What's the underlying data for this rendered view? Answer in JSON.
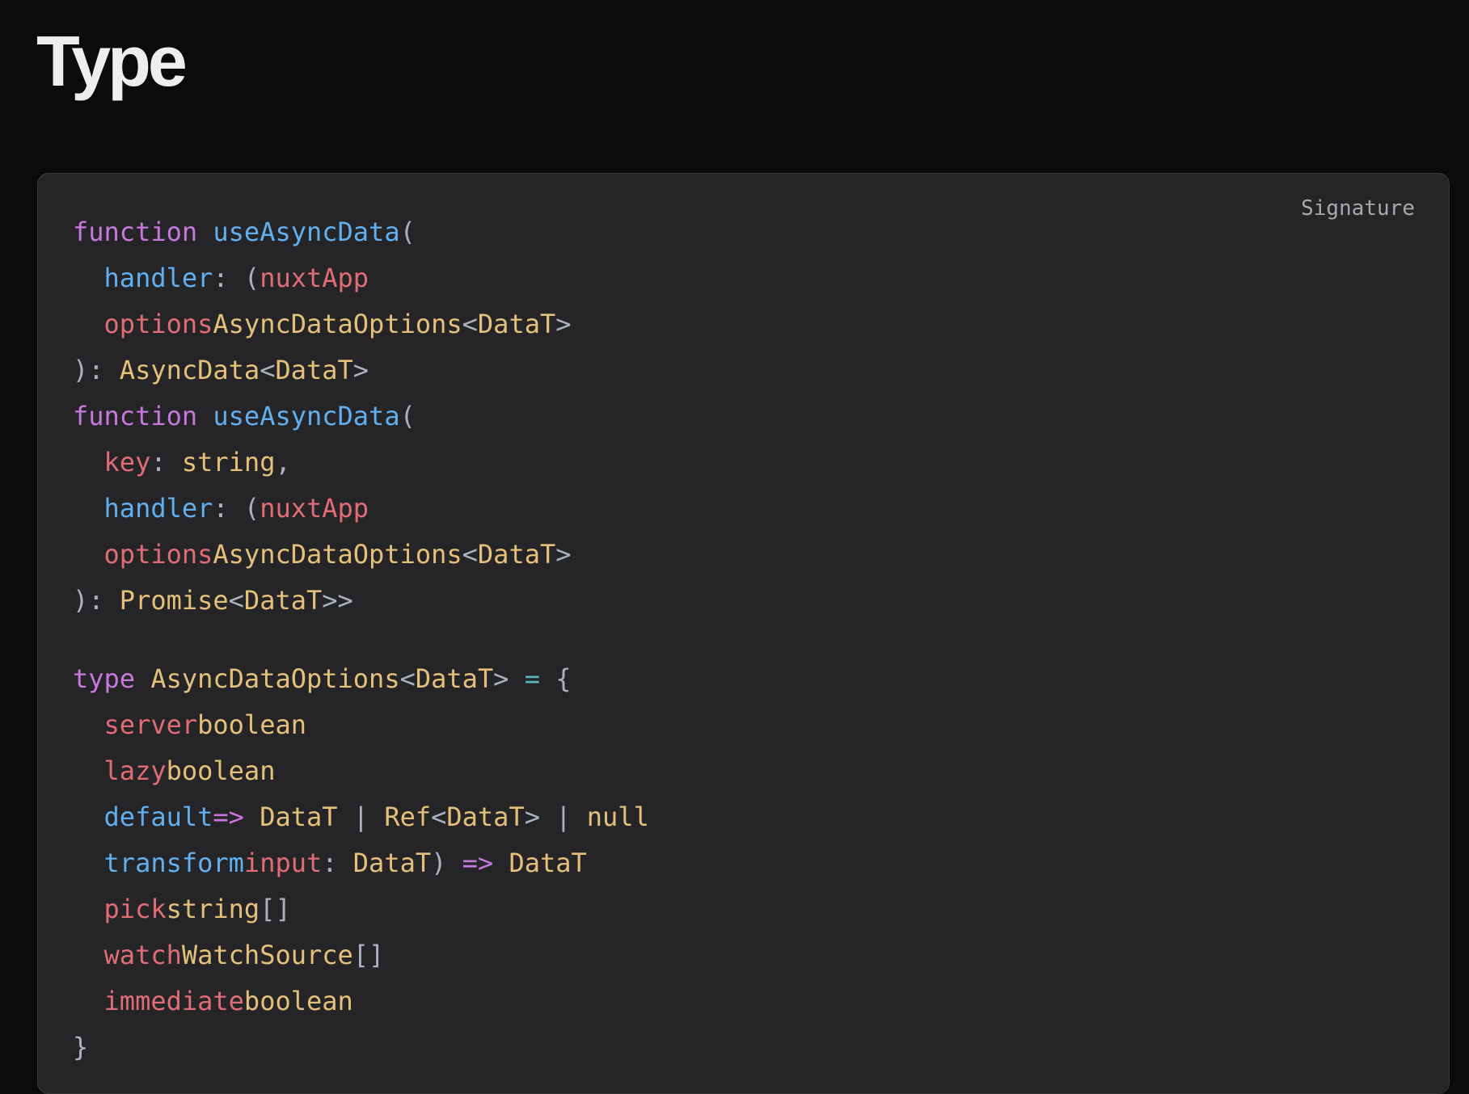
{
  "page": {
    "title": "Type"
  },
  "code_block": {
    "label": "Signature",
    "colors": {
      "keyword": "#c678dd",
      "function": "#61afef",
      "variable": "#e06c75",
      "type": "#e5c07b",
      "punctuation": "#abb2bf",
      "operator": "#56b6c2",
      "background": "#252527"
    },
    "lines": [
      [
        {
          "t": "function",
          "c": "kw"
        },
        {
          "t": " ",
          "c": "punc"
        },
        {
          "t": "useAsyncData",
          "c": "fn"
        },
        {
          "t": "(",
          "c": "punc"
        }
      ],
      [
        {
          "t": "  ",
          "c": "punc"
        },
        {
          "t": "handler",
          "c": "fn"
        },
        {
          "t": ": (",
          "c": "punc"
        },
        {
          "t": "nuxtApp",
          "c": "var"
        }
      ],
      [
        {
          "t": "  ",
          "c": "punc"
        },
        {
          "t": "options",
          "c": "var"
        },
        {
          "t": "AsyncDataOptions",
          "c": "type"
        },
        {
          "t": "<",
          "c": "punc"
        },
        {
          "t": "DataT",
          "c": "type"
        },
        {
          "t": ">",
          "c": "punc"
        }
      ],
      [
        {
          "t": "): ",
          "c": "punc"
        },
        {
          "t": "AsyncData",
          "c": "type"
        },
        {
          "t": "<",
          "c": "punc"
        },
        {
          "t": "DataT",
          "c": "type"
        },
        {
          "t": ">",
          "c": "punc"
        }
      ],
      [
        {
          "t": "function",
          "c": "kw"
        },
        {
          "t": " ",
          "c": "punc"
        },
        {
          "t": "useAsyncData",
          "c": "fn"
        },
        {
          "t": "(",
          "c": "punc"
        }
      ],
      [
        {
          "t": "  ",
          "c": "punc"
        },
        {
          "t": "key",
          "c": "var"
        },
        {
          "t": ": ",
          "c": "punc"
        },
        {
          "t": "string",
          "c": "type"
        },
        {
          "t": ",",
          "c": "punc"
        }
      ],
      [
        {
          "t": "  ",
          "c": "punc"
        },
        {
          "t": "handler",
          "c": "fn"
        },
        {
          "t": ": (",
          "c": "punc"
        },
        {
          "t": "nuxtApp",
          "c": "var"
        }
      ],
      [
        {
          "t": "  ",
          "c": "punc"
        },
        {
          "t": "options",
          "c": "var"
        },
        {
          "t": "AsyncDataOptions",
          "c": "type"
        },
        {
          "t": "<",
          "c": "punc"
        },
        {
          "t": "DataT",
          "c": "type"
        },
        {
          "t": ">",
          "c": "punc"
        }
      ],
      [
        {
          "t": "): ",
          "c": "punc"
        },
        {
          "t": "Promise",
          "c": "type"
        },
        {
          "t": "<",
          "c": "punc"
        },
        {
          "t": "DataT",
          "c": "type"
        },
        {
          "t": ">>",
          "c": "punc"
        }
      ],
      [],
      [
        {
          "t": "type",
          "c": "kw"
        },
        {
          "t": " ",
          "c": "punc"
        },
        {
          "t": "AsyncDataOptions",
          "c": "type"
        },
        {
          "t": "<",
          "c": "punc"
        },
        {
          "t": "DataT",
          "c": "type"
        },
        {
          "t": "> ",
          "c": "punc"
        },
        {
          "t": "=",
          "c": "op"
        },
        {
          "t": " {",
          "c": "punc"
        }
      ],
      [
        {
          "t": "  ",
          "c": "punc"
        },
        {
          "t": "server",
          "c": "var"
        },
        {
          "t": "boolean",
          "c": "type"
        }
      ],
      [
        {
          "t": "  ",
          "c": "punc"
        },
        {
          "t": "lazy",
          "c": "var"
        },
        {
          "t": "boolean",
          "c": "type"
        }
      ],
      [
        {
          "t": "  ",
          "c": "punc"
        },
        {
          "t": "default",
          "c": "fn"
        },
        {
          "t": "=>",
          "c": "kw"
        },
        {
          "t": " ",
          "c": "punc"
        },
        {
          "t": "DataT",
          "c": "type"
        },
        {
          "t": " | ",
          "c": "punc"
        },
        {
          "t": "Ref",
          "c": "type"
        },
        {
          "t": "<",
          "c": "punc"
        },
        {
          "t": "DataT",
          "c": "type"
        },
        {
          "t": "> | ",
          "c": "punc"
        },
        {
          "t": "null",
          "c": "type"
        }
      ],
      [
        {
          "t": "  ",
          "c": "punc"
        },
        {
          "t": "transform",
          "c": "fn"
        },
        {
          "t": "input",
          "c": "var"
        },
        {
          "t": ": ",
          "c": "punc"
        },
        {
          "t": "DataT",
          "c": "type"
        },
        {
          "t": ") ",
          "c": "punc"
        },
        {
          "t": "=>",
          "c": "kw"
        },
        {
          "t": " ",
          "c": "punc"
        },
        {
          "t": "DataT",
          "c": "type"
        }
      ],
      [
        {
          "t": "  ",
          "c": "punc"
        },
        {
          "t": "pick",
          "c": "var"
        },
        {
          "t": "string",
          "c": "type"
        },
        {
          "t": "[]",
          "c": "punc"
        }
      ],
      [
        {
          "t": "  ",
          "c": "punc"
        },
        {
          "t": "watch",
          "c": "var"
        },
        {
          "t": "WatchSource",
          "c": "type"
        },
        {
          "t": "[]",
          "c": "punc"
        }
      ],
      [
        {
          "t": "  ",
          "c": "punc"
        },
        {
          "t": "immediate",
          "c": "var"
        },
        {
          "t": "boolean",
          "c": "type"
        }
      ],
      [
        {
          "t": "}",
          "c": "punc"
        }
      ]
    ]
  }
}
